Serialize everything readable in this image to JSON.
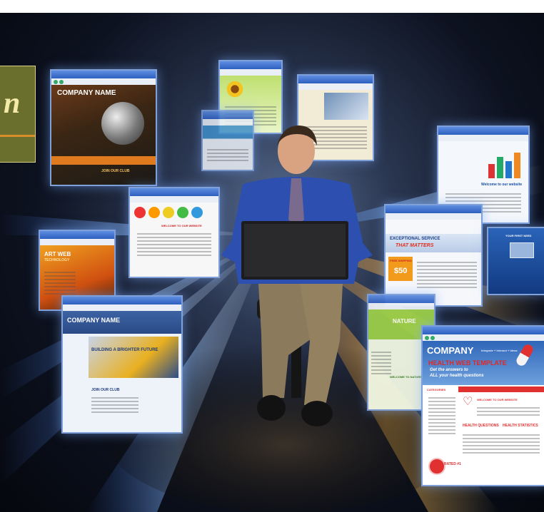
{
  "olive_panel": {
    "letter": "n"
  },
  "windows": {
    "company_name_dark": {
      "title": "COMPANY NAME",
      "footer_text": "JOIN OUR CLUB"
    },
    "nature_flower": {
      "title": ""
    },
    "building": {
      "title": ""
    },
    "small_blue": {
      "title": ""
    },
    "chart_site": {
      "heading": "Welcome to our website"
    },
    "tabs_site": {
      "heading": "WELCOME TO OUR WEBSITE"
    },
    "art_web": {
      "title": "ART WEB",
      "subtitle": "TECHNOLOGY"
    },
    "business": {
      "headline": "EXCEPTIONAL SERVICE",
      "tagline": "THAT MATTERS",
      "promo": "FREE SHIPPING",
      "price": "$50"
    },
    "right_edge": {
      "heading": "YOUR FIRST NEED"
    },
    "company_blue": {
      "title": "COMPANY NAME",
      "banner": "BUILDING A BRIGHTER FUTURE",
      "join": "JOIN OUR CLUB"
    },
    "nature": {
      "title": "NATURE",
      "welcome": "WELCOME TO NATURE"
    },
    "health": {
      "company": "COMPANY",
      "tagline": "Integrate + Interact + Ideas",
      "heading": "HEALTH WEB TEMPLATE",
      "sub1": "Get the answers to",
      "sub2": "ALL your health questions",
      "categories": "CATEGORIES",
      "welcome": "WELCOME TO OUR WEBSITE",
      "q1": "HEALTH QUESTIONS",
      "q2": "HEALTH STATISTICS",
      "rated": "RATED #1"
    }
  }
}
